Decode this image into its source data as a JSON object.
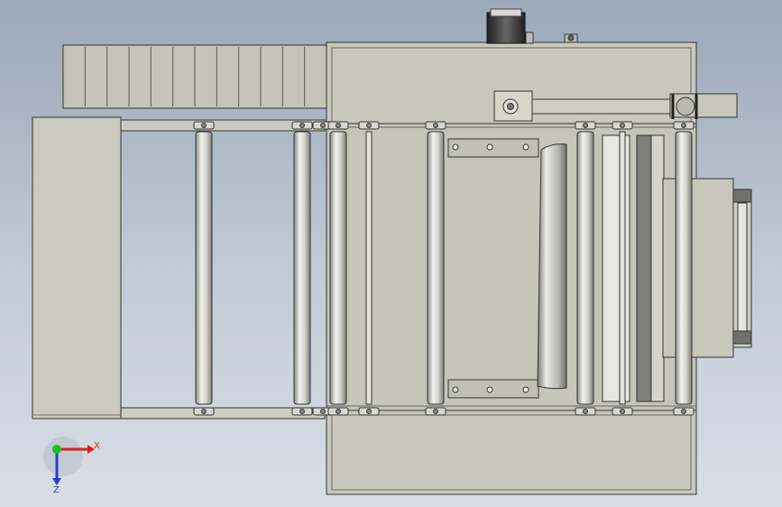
{
  "view": {
    "type": "CAD top view - roller conveyor assembly",
    "background_top": "#9aa8b8",
    "background_bottom": "#d9dee6",
    "part_color": "#c9c8bc",
    "edge_color": "#333333"
  },
  "triad": {
    "x_label": "X",
    "z_label": "Z",
    "x_color": "#e02020",
    "y_color": "#20c020",
    "z_color": "#2040d0"
  },
  "assembly": {
    "infeed_plates": 12,
    "roller_count": 8,
    "bolt_count": 12
  }
}
